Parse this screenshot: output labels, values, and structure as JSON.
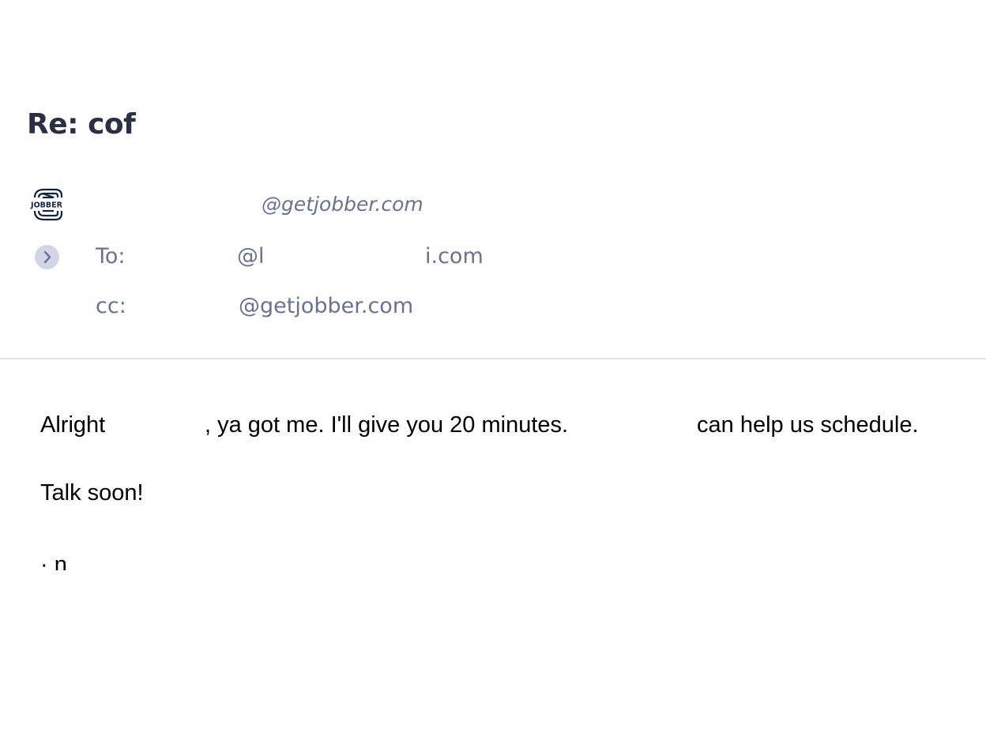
{
  "email": {
    "subject": "Re: cof",
    "sender": {
      "logo_icon": "jobber-logo-icon",
      "logo_text": "JOBBER",
      "email": "@getjobber.com"
    },
    "to": {
      "label": "To:",
      "value_start": "@l",
      "value_end": "i.com"
    },
    "cc": {
      "label": "cc:",
      "value": "@getjobber.com"
    },
    "expand_icon": "chevron-right-icon",
    "body": {
      "line1_start": "Alright",
      "line1_middle": ", ya got me. I'll give you 20 minutes.",
      "line1_end": "can help us schedule.",
      "line2": "Talk soon!",
      "signature": "·    n"
    }
  },
  "colors": {
    "subject": "#2b2f45",
    "meta_text": "#6b7191",
    "expand_button_bg": "#d3d5e7",
    "divider": "#e2e3e8",
    "logo": "#14233a"
  }
}
